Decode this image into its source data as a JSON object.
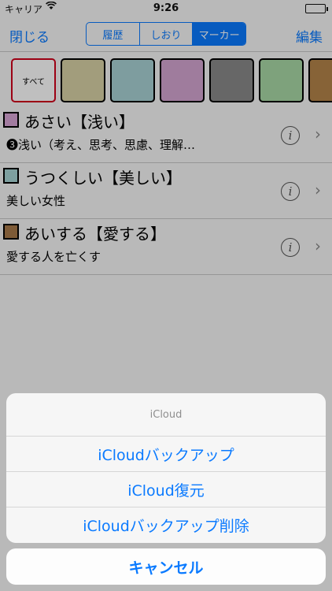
{
  "status_bar": {
    "carrier": "キャリア",
    "wifi_icon": "wifi-icon",
    "time": "9:26",
    "battery_icon": "battery-icon"
  },
  "navbar": {
    "close_label": "閉じる",
    "edit_label": "編集",
    "segments": [
      {
        "label": "履歴",
        "active": false
      },
      {
        "label": "しおり",
        "active": false
      },
      {
        "label": "マーカー",
        "active": true
      }
    ]
  },
  "palette": {
    "all_label": "すべて",
    "colors": [
      "#d8d2a6",
      "#a9d2d4",
      "#d4a6d2",
      "#8a8a8a",
      "#a9d9a6",
      "#b5844a"
    ]
  },
  "entries": [
    {
      "color": "#d9a6d6",
      "title": "あさい【浅い】",
      "subtitle": "❸浅い（考え、思考、思慮、理解…"
    },
    {
      "color": "#a9d6d6",
      "title": "うつくしい【美しい】",
      "subtitle": "美しい女性"
    },
    {
      "color": "#a97a4a",
      "title": "あいする【愛する】",
      "subtitle": "愛する人を亡くす"
    }
  ],
  "action_sheet": {
    "title": "iCloud",
    "actions": [
      "iCloudバックアップ",
      "iCloud復元",
      "iCloudバックアップ削除"
    ],
    "cancel_label": "キャンセル"
  }
}
